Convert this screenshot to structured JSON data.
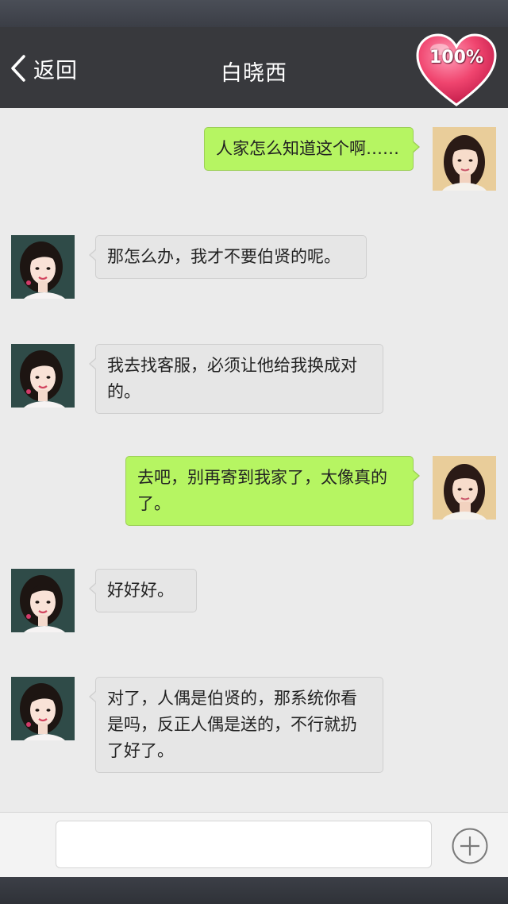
{
  "header": {
    "back_label": "返回",
    "title": "白晓西",
    "affection": "100%"
  },
  "messages": [
    {
      "side": "me",
      "text": "人家怎么知道这个啊……"
    },
    {
      "side": "her",
      "text": "那怎么办，我才不要伯贤的呢。"
    },
    {
      "side": "her",
      "text": "我去找客服，必须让他给我换成对的。"
    },
    {
      "side": "me",
      "text": "去吧，别再寄到我家了，太像真的了。"
    },
    {
      "side": "her",
      "text": "好好好。"
    },
    {
      "side": "her",
      "text": "对了，人偶是伯贤的，那系统你看是吗，反正人偶是送的，不行就扔了好了。"
    }
  ],
  "input": {
    "placeholder": ""
  },
  "icons": {
    "back": "chevron-left-icon",
    "heart": "heart-icon",
    "plus": "plus-circle-icon"
  },
  "colors": {
    "header_bg": "#38393d",
    "chat_bg": "#ebebeb",
    "my_bubble": "#b6f562",
    "her_bubble": "#e6e6e6",
    "heart": "#f0456f"
  }
}
